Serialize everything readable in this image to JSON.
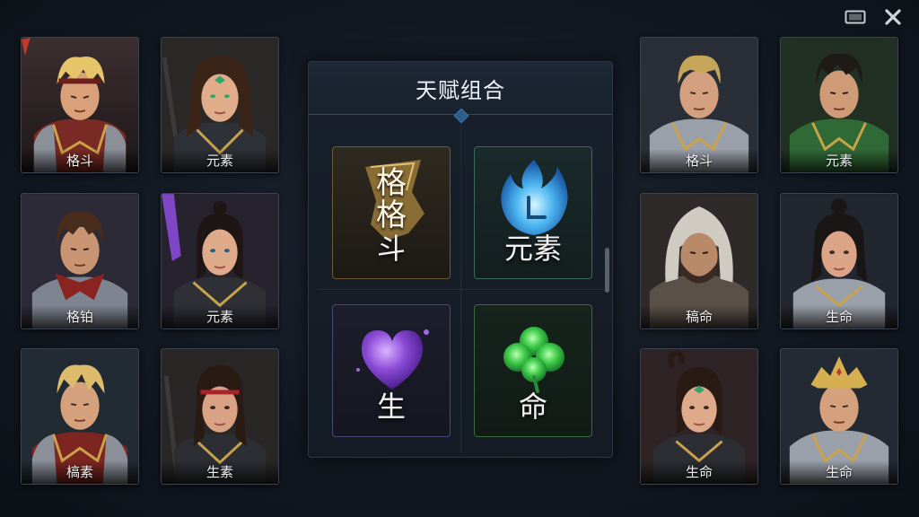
{
  "panel": {
    "title": "天赋组合"
  },
  "talents": [
    {
      "label": "斗",
      "glyph_top": "格",
      "glyph_mid": "格",
      "icon": "fist-glyph-icon"
    },
    {
      "label": "元素",
      "icon": "blue-flame-icon"
    },
    {
      "label": "生",
      "icon": "purple-heart-icon"
    },
    {
      "label": "命",
      "icon": "green-clover-icon"
    }
  ],
  "left_cards": [
    {
      "label": "格斗",
      "theme": "red-armor-headband"
    },
    {
      "label": "元素",
      "theme": "female-green-eyes"
    },
    {
      "label": "格铂",
      "theme": "brown-hair-red-collar"
    },
    {
      "label": "元素",
      "theme": "female-purple-sword"
    },
    {
      "label": "槁素",
      "theme": "blond-red-armor"
    },
    {
      "label": "生素",
      "theme": "female-red-headband"
    }
  ],
  "right_cards": [
    {
      "label": "格斗",
      "theme": "blond-silver-armor"
    },
    {
      "label": "元素",
      "theme": "dark-hair-green-armor"
    },
    {
      "label": "稿命",
      "theme": "hooded-bearded"
    },
    {
      "label": "生命",
      "theme": "female-ponytail-silver"
    },
    {
      "label": "生命",
      "theme": "female-green-gem"
    },
    {
      "label": "生命",
      "theme": "gold-crown-silver"
    }
  ],
  "top_icons": [
    "screen-icon",
    "close-icon"
  ],
  "colors": {
    "accent": "#3d76ad",
    "panel": "#18202b",
    "gold": "#c9a24a"
  }
}
